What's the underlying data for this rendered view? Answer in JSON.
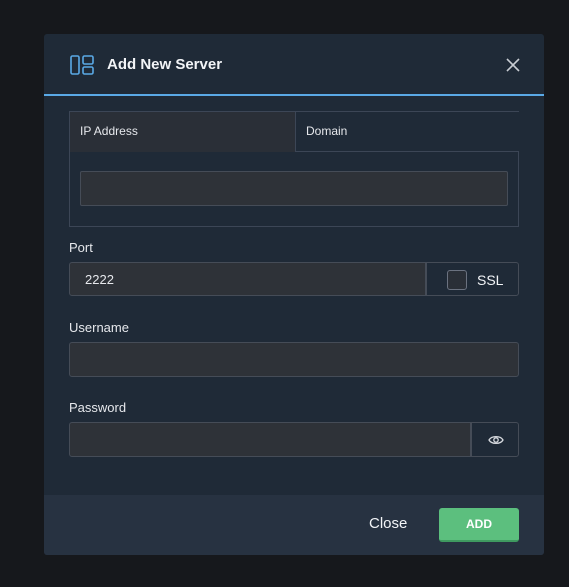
{
  "dialog": {
    "title": "Add New Server",
    "tabs": [
      {
        "label": "IP Address",
        "active": true
      },
      {
        "label": "Domain",
        "active": false
      }
    ],
    "address_value": "",
    "port": {
      "label": "Port",
      "value": "2222"
    },
    "ssl": {
      "label": "SSL",
      "checked": false
    },
    "username": {
      "label": "Username",
      "value": ""
    },
    "password": {
      "label": "Password",
      "value": ""
    },
    "footer": {
      "close_label": "Close",
      "add_label": "ADD"
    }
  },
  "colors": {
    "accent": "#5aa9e6",
    "add_button": "#5cbf7e",
    "modal_bg": "#1f2a37",
    "footer_bg": "#273241"
  },
  "icons": {
    "header": "server-layout-icon",
    "close": "close-icon",
    "password_toggle": "eye-icon"
  }
}
